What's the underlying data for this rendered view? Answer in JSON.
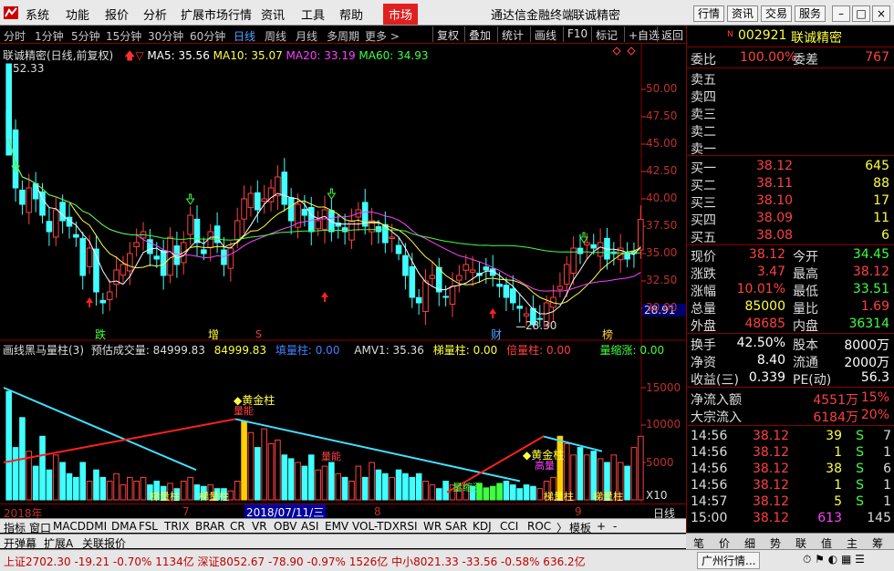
{
  "menu": {
    "items": [
      "系统",
      "功能",
      "报价",
      "分析",
      "扩展市场行情",
      "资讯",
      "工具",
      "帮助"
    ],
    "active": "市场",
    "app_title": "通达信金融终端",
    "stock_title": "联诚精密",
    "buttons": [
      "行情",
      "资讯",
      "交易",
      "服务"
    ]
  },
  "toolbar": {
    "periods": [
      "分时",
      "1分钟",
      "5分钟",
      "15分钟",
      "30分钟",
      "60分钟",
      "日线",
      "周线",
      "月线",
      "多周期",
      "更多 >"
    ],
    "selected": "日线",
    "buttons": [
      "复权",
      "叠加",
      "统计",
      "画线",
      "F10",
      "标记",
      "+自选",
      "返回"
    ]
  },
  "chart_header": {
    "name": "联诚精密(日线,前复权)",
    "ma5": "MA5: 35.56",
    "ma10": "MA10: 35.07",
    "ma20": "MA20: 33.19",
    "ma60": "MA60: 34.93",
    "high_label": "52.33",
    "low_label": "28.30",
    "price_tag": "28.91",
    "y_ticks": [
      "50.00",
      "47.50",
      "45.00",
      "42.50",
      "40.00",
      "37.50",
      "35.00",
      "32.50",
      "30.00"
    ],
    "markers": [
      "跌",
      "增",
      "S",
      "财",
      "榜"
    ]
  },
  "sub_header": {
    "name": "画线黑马量柱(3)",
    "est": "预估成交量: 84999.83",
    "val": "84999.83",
    "fill": "填量柱: 0.00",
    "amv": "AMV1: 35.36",
    "ladder": "梯量柱: 0.00",
    "double": "倍量柱: 0.00",
    "shrink": "量缩涨: 0.00",
    "y_ticks": [
      "15000",
      "10000",
      "5000"
    ],
    "unit": "X10",
    "annotations": [
      "黄金柱",
      "量能",
      "量能",
      "黄金柱",
      "梯量柱",
      "梯量柱",
      "量缩涨",
      "梯量柱",
      "梯量柱",
      "高量"
    ]
  },
  "date_axis": {
    "labels": [
      "2018年",
      "7",
      "2018/07/11/三",
      "8",
      "9"
    ],
    "right": "日线"
  },
  "indicator_tabs": [
    "指标",
    "窗口",
    "MACD",
    "DMI",
    "DMA",
    "FSL",
    "TRIX",
    "BRAR",
    "CR",
    "VR",
    "OBV",
    "ASI",
    "EMV",
    "VOL-TDX",
    "RSI",
    "WR",
    "SAR",
    "KDJ",
    "CCI",
    "ROC",
    "〉",
    "模板",
    "+",
    "-"
  ],
  "bottom_tabs": [
    "开弹幕",
    "扩展A",
    "关联报价"
  ],
  "right_tabs": [
    "笔",
    "价",
    "细",
    "势",
    "联",
    "值",
    "主",
    "筹"
  ],
  "status": {
    "text": "上证2702.30 -19.21 -0.70% 1134亿 深证8052.67 -78.90 -0.97% 1526亿 中小8021.33 -33.56 -0.58% 636.2亿",
    "broker": "广州行情..."
  },
  "quote": {
    "code": "002921",
    "name": "联诚精密",
    "weibi_label": "委比",
    "weibi": "100.00%",
    "weicha_label": "委差",
    "weicha": "767",
    "sells": [
      {
        "label": "卖五"
      },
      {
        "label": "卖四"
      },
      {
        "label": "卖三"
      },
      {
        "label": "卖二"
      },
      {
        "label": "卖一"
      }
    ],
    "buys": [
      {
        "label": "买一",
        "price": "38.12",
        "vol": "645"
      },
      {
        "label": "买二",
        "price": "38.11",
        "vol": "88"
      },
      {
        "label": "买三",
        "price": "38.10",
        "vol": "17"
      },
      {
        "label": "买四",
        "price": "38.09",
        "vol": "11"
      },
      {
        "label": "买五",
        "price": "38.08",
        "vol": "6"
      }
    ],
    "stats": [
      {
        "l1": "现价",
        "v1": "38.12",
        "l2": "今开",
        "v2": "34.45"
      },
      {
        "l1": "涨跌",
        "v1": "3.47",
        "l2": "最高",
        "v2": "38.12"
      },
      {
        "l1": "涨幅",
        "v1": "10.01%",
        "l2": "最低",
        "v2": "33.51"
      },
      {
        "l1": "总量",
        "v1": "85000",
        "l2": "量比",
        "v2": "1.69"
      },
      {
        "l1": "外盘",
        "v1": "48685",
        "l2": "内盘",
        "v2": "36314"
      }
    ],
    "fund": [
      {
        "l1": "换手",
        "v1": "42.50%",
        "l2": "股本",
        "v2": "8000万"
      },
      {
        "l1": "净资",
        "v1": "8.40",
        "l2": "流通",
        "v2": "2000万"
      },
      {
        "l1": "收益(三)",
        "v1": "0.339",
        "l2": "PE(动)",
        "v2": "56.3"
      }
    ],
    "flows": [
      {
        "l": "净流入额",
        "v": "4551万",
        "p": "15%"
      },
      {
        "l": "大宗流入",
        "v": "6184万",
        "p": "20%"
      }
    ],
    "ticks": [
      {
        "t": "14:56",
        "p": "38.12",
        "v": "39",
        "s": "S",
        "n": "7"
      },
      {
        "t": "14:56",
        "p": "38.12",
        "v": "1",
        "s": "S",
        "n": "1"
      },
      {
        "t": "14:56",
        "p": "38.12",
        "v": "38",
        "s": "S",
        "n": "6"
      },
      {
        "t": "14:56",
        "p": "38.12",
        "v": "1",
        "s": "S",
        "n": "1"
      },
      {
        "t": "14:57",
        "p": "38.12",
        "v": "5",
        "s": "S",
        "n": "1"
      },
      {
        "t": "15:00",
        "p": "38.12",
        "v": "613",
        "s": "",
        "n": "145"
      }
    ]
  },
  "colors": {
    "up": "#ff4040",
    "down": "#40ffff",
    "ma5": "#ffffff",
    "ma10": "#ffff40",
    "ma20": "#ff40ff",
    "ma60": "#40ff40"
  }
}
